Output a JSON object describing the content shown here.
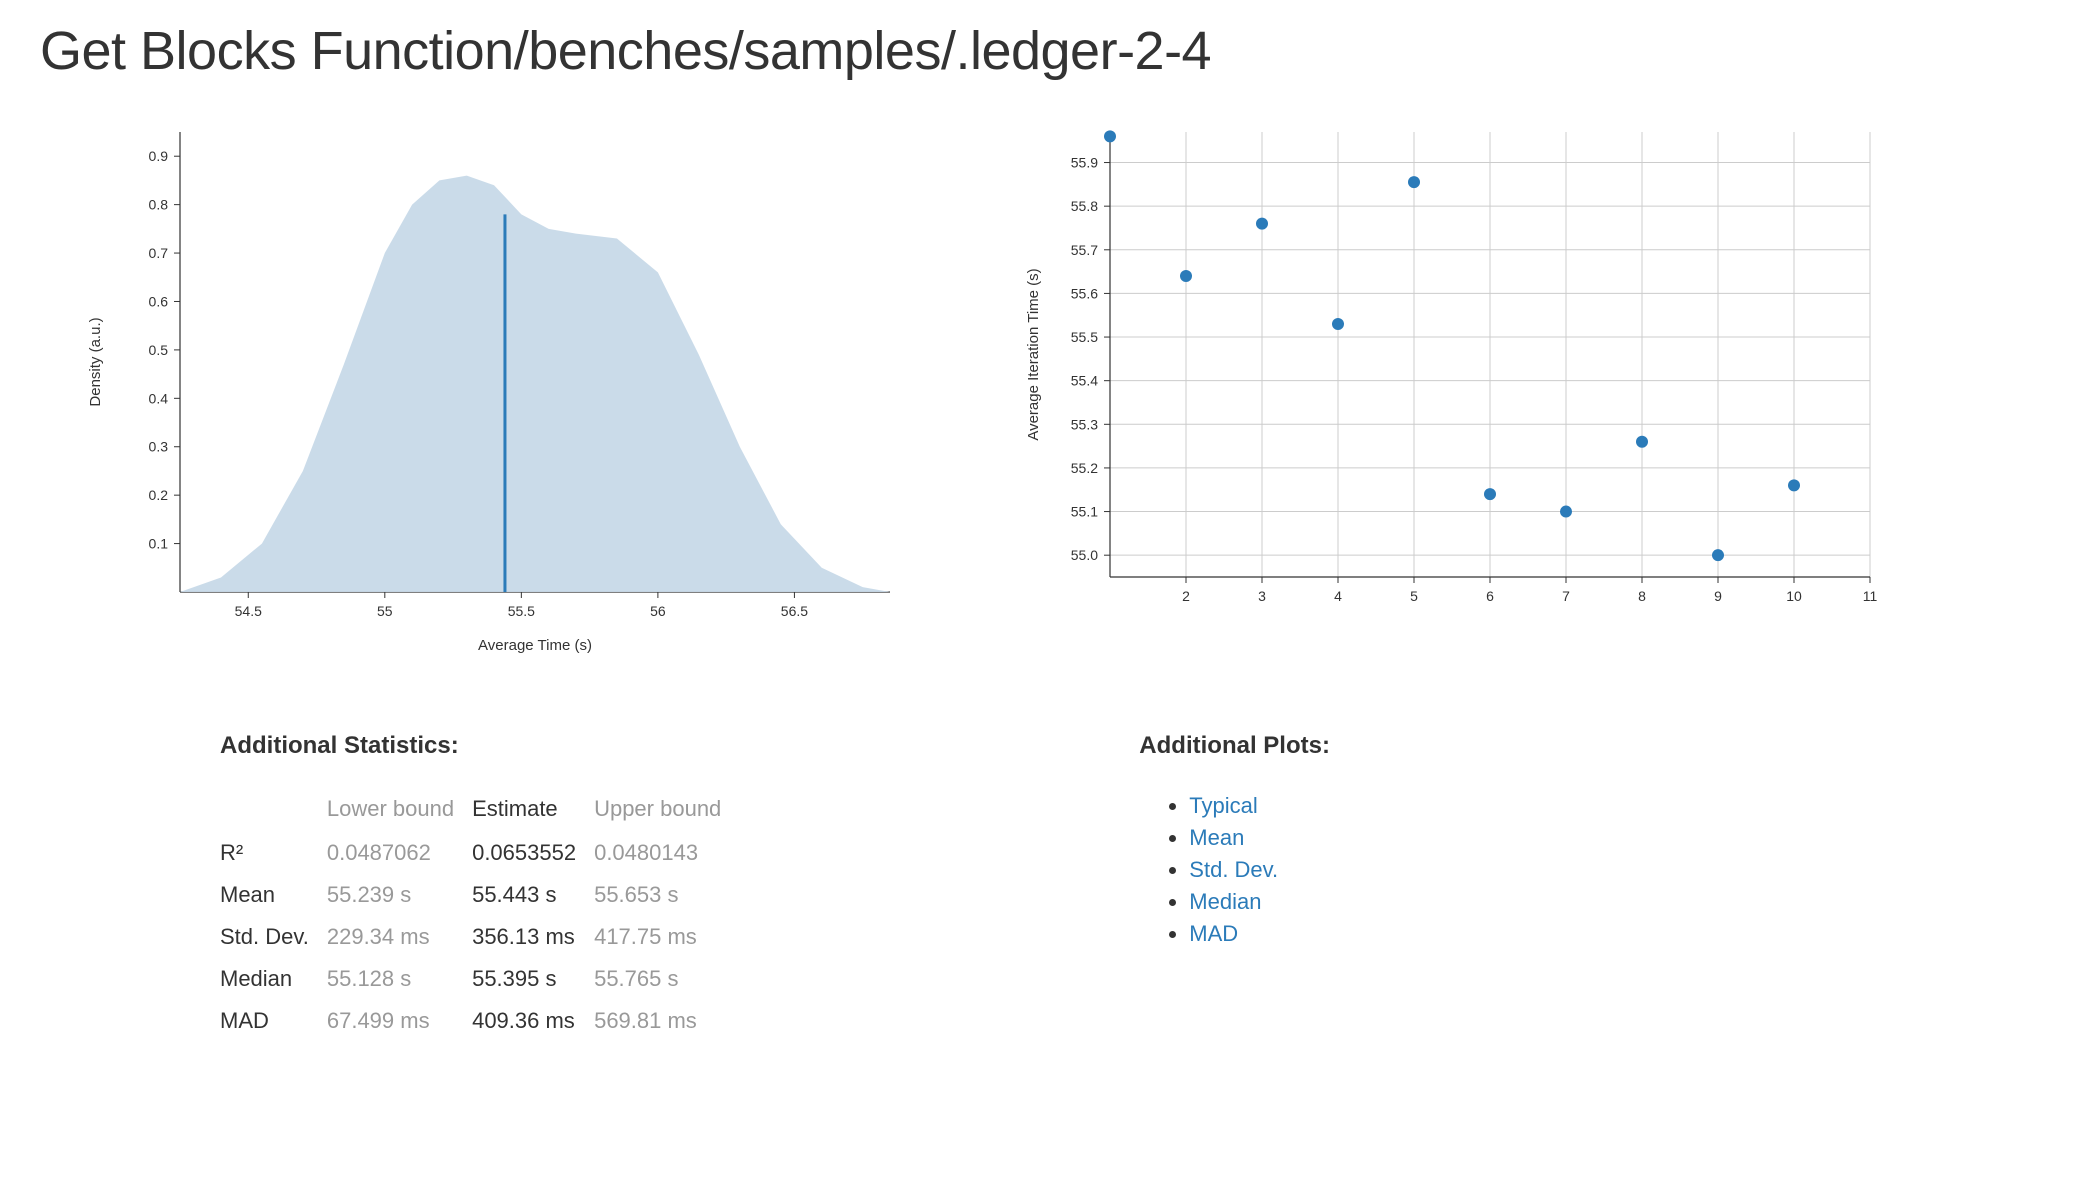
{
  "page_title": "Get Blocks Function/benches/samples/.ledger-2-4",
  "chart_data": [
    {
      "type": "area",
      "title": "",
      "xlabel": "Average Time (s)",
      "ylabel": "Density (a.u.)",
      "xlim": [
        54.25,
        56.85
      ],
      "ylim": [
        0,
        0.95
      ],
      "x_ticks": [
        54.5,
        55,
        55.5,
        56,
        56.5
      ],
      "y_ticks": [
        0.1,
        0.2,
        0.3,
        0.4,
        0.5,
        0.6,
        0.7,
        0.8,
        0.9
      ],
      "vline_x": 55.44,
      "series": [
        {
          "name": "density",
          "x": [
            54.25,
            54.4,
            54.55,
            54.7,
            54.85,
            55.0,
            55.1,
            55.2,
            55.3,
            55.4,
            55.5,
            55.6,
            55.7,
            55.85,
            56.0,
            56.15,
            56.3,
            56.45,
            56.6,
            56.75,
            56.85
          ],
          "values": [
            0.0,
            0.03,
            0.1,
            0.25,
            0.47,
            0.7,
            0.8,
            0.85,
            0.86,
            0.84,
            0.78,
            0.75,
            0.74,
            0.73,
            0.66,
            0.49,
            0.3,
            0.14,
            0.05,
            0.01,
            0.0
          ]
        }
      ]
    },
    {
      "type": "scatter",
      "title": "",
      "xlabel": "",
      "ylabel": "Average Iteration Time (s)",
      "xlim": [
        1,
        11
      ],
      "ylim": [
        54.95,
        55.97
      ],
      "x_ticks": [
        2,
        3,
        4,
        5,
        6,
        7,
        8,
        9,
        10,
        11
      ],
      "y_ticks": [
        55.0,
        55.1,
        55.2,
        55.3,
        55.4,
        55.5,
        55.6,
        55.7,
        55.8,
        55.9
      ],
      "series": [
        {
          "name": "iterations",
          "x": [
            1,
            2,
            3,
            4,
            5,
            6,
            7,
            8,
            9,
            10
          ],
          "y": [
            55.96,
            55.64,
            55.76,
            55.53,
            55.855,
            55.14,
            55.1,
            55.26,
            55.0,
            55.16
          ]
        }
      ]
    }
  ],
  "stats": {
    "heading": "Additional Statistics:",
    "columns": [
      "",
      "Lower bound",
      "Estimate",
      "Upper bound"
    ],
    "rows": [
      {
        "label": "R²",
        "lower": "0.0487062",
        "estimate": "0.0653552",
        "upper": "0.0480143"
      },
      {
        "label": "Mean",
        "lower": "55.239 s",
        "estimate": "55.443 s",
        "upper": "55.653 s"
      },
      {
        "label": "Std. Dev.",
        "lower": "229.34 ms",
        "estimate": "356.13 ms",
        "upper": "417.75 ms"
      },
      {
        "label": "Median",
        "lower": "55.128 s",
        "estimate": "55.395 s",
        "upper": "55.765 s"
      },
      {
        "label": "MAD",
        "lower": "67.499 ms",
        "estimate": "409.36 ms",
        "upper": "569.81 ms"
      }
    ]
  },
  "plots": {
    "heading": "Additional Plots:",
    "items": [
      "Typical",
      "Mean",
      "Std. Dev.",
      "Median",
      "MAD"
    ]
  }
}
